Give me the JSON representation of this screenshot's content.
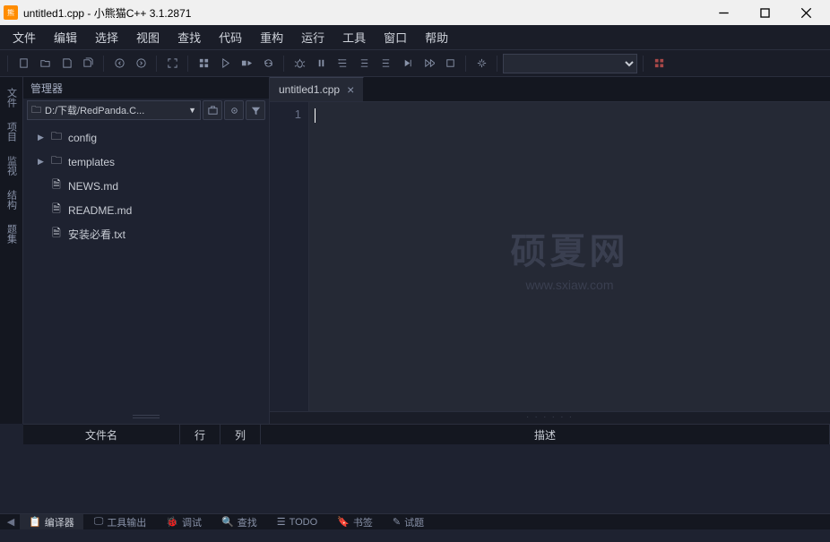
{
  "titlebar": {
    "title": "untitled1.cpp - 小熊猫C++ 3.1.2871"
  },
  "menubar": {
    "items": [
      "文件",
      "编辑",
      "选择",
      "视图",
      "查找",
      "代码",
      "重构",
      "运行",
      "工具",
      "窗口",
      "帮助"
    ]
  },
  "panel": {
    "title": "管理器",
    "path": "D:/下载/RedPanda.C..."
  },
  "sidebar_labels": {
    "files": "文件",
    "project": "项目",
    "watch": "监视",
    "struct": "结构",
    "problemset": "题集"
  },
  "tree": {
    "items": [
      {
        "kind": "folder",
        "name": "config"
      },
      {
        "kind": "folder",
        "name": "templates"
      },
      {
        "kind": "file",
        "name": "NEWS.md"
      },
      {
        "kind": "file",
        "name": "README.md"
      },
      {
        "kind": "file",
        "name": "安装必看.txt"
      }
    ]
  },
  "editor_tab": {
    "label": "untitled1.cpp"
  },
  "gutter": {
    "line1": "1"
  },
  "watermark": {
    "big": "硕夏网",
    "small": "www.sxiaw.com"
  },
  "bottom_headers": {
    "c1": "文件名",
    "c2": "行",
    "c3": "列",
    "c4": "描述"
  },
  "bottom_tabs": {
    "t1": "编译器",
    "t2": "工具输出",
    "t3": "调试",
    "t4": "查找",
    "t5": "TODO",
    "t6": "书签",
    "t7": "试题"
  }
}
